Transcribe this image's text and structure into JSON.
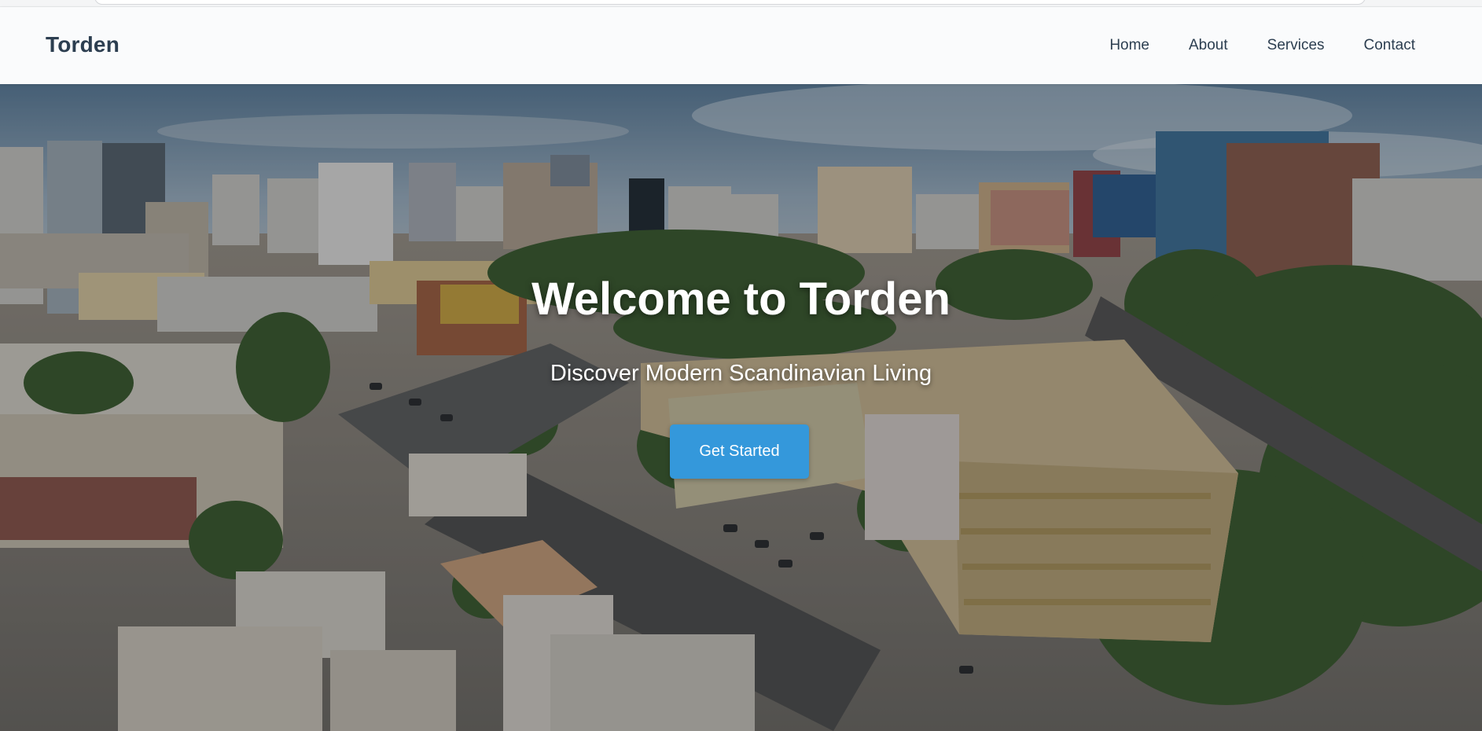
{
  "navbar": {
    "brand": "Torden",
    "links": [
      "Home",
      "About",
      "Services",
      "Contact"
    ]
  },
  "hero": {
    "title": "Welcome to Torden",
    "subtitle": "Discover Modern Scandinavian Living",
    "cta_label": "Get Started"
  },
  "colors": {
    "brand_text": "#2c3e50",
    "accent": "#3498db",
    "navbar_bg": "#fafbfc"
  }
}
